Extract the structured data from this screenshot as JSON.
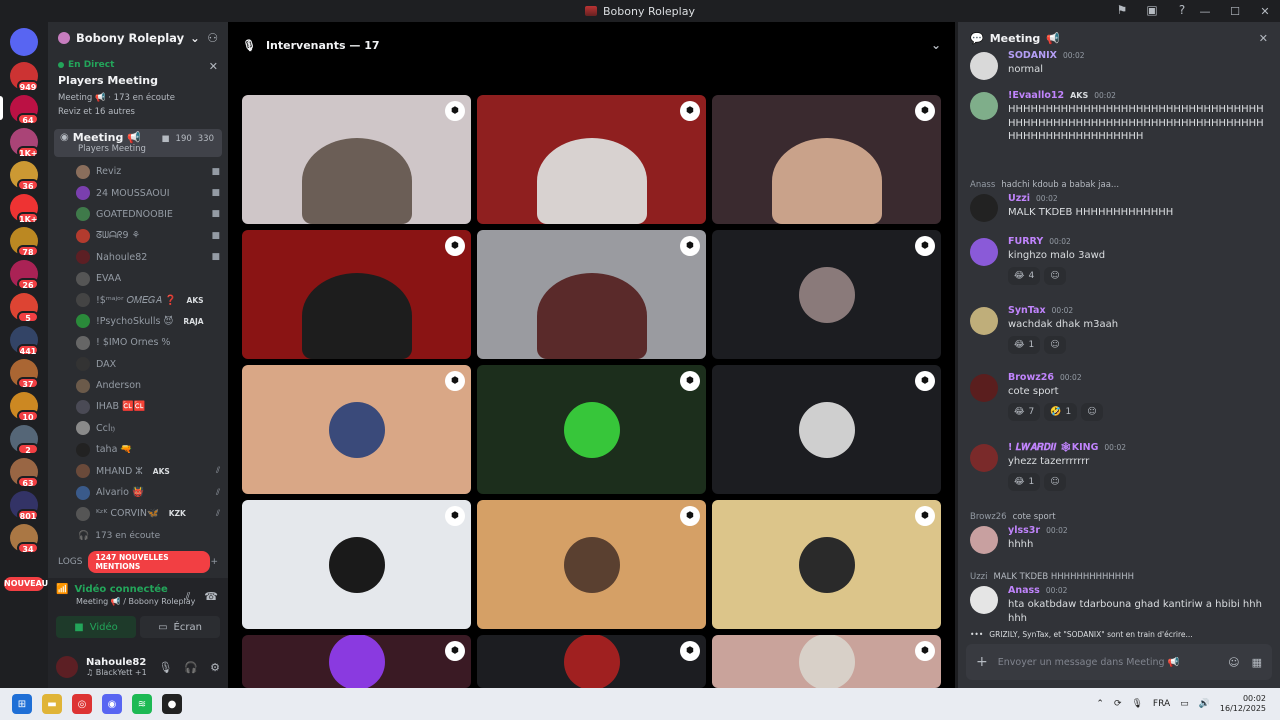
{
  "window": {
    "title": "Bobony Roleplay",
    "controls": [
      "—",
      "☐",
      "✕"
    ]
  },
  "rail": {
    "badges": [
      "949",
      "64",
      "1K+",
      "36",
      "1K+",
      "78",
      "26",
      "5",
      "441",
      "37",
      "10",
      "2",
      "63",
      "801",
      "34"
    ],
    "nouveau": "NOUVEAU"
  },
  "sidebar": {
    "guild_name": "Bobony Roleplay",
    "live_label": "En Direct",
    "event_name": "Players Meeting",
    "event_meta": "Meeting 📢 · 173 en écoute",
    "event_reviz": "Reviz et 16 autres",
    "channel": {
      "name": "Meeting",
      "sub": "Players Meeting",
      "cams": "190",
      "listeners": "330"
    },
    "members": [
      {
        "name": "Reviz",
        "tag": "",
        "right": "cam",
        "color": "#8a6e5c"
      },
      {
        "name": "24 MOUSSAOUI",
        "tag": "",
        "right": "cam",
        "color": "#7a3fae"
      },
      {
        "name": "GOATEDNOOBIE",
        "tag": "",
        "right": "cam",
        "color": "#3f7a4a"
      },
      {
        "name": "ᘔᗯᗩᖇ9 ⚘",
        "tag": "",
        "right": "cam",
        "color": "#b33b2e"
      },
      {
        "name": "Nahoule82",
        "tag": "",
        "right": "cam",
        "color": "#5c1f24"
      },
      {
        "name": "EVAA",
        "tag": "",
        "right": "",
        "color": "#555"
      },
      {
        "name": "!$ᵐᵃʲᵒʳ 𝑂𝑀𝐸𝐺𝐴 ❓",
        "tag": "AKS",
        "right": "",
        "color": "#444"
      },
      {
        "name": "!PsychoSkulls 😈",
        "tag": "RAJA",
        "right": "",
        "color": "#2a8a3a"
      },
      {
        "name": "! $IMO Ornes %",
        "tag": "",
        "right": "",
        "color": "#666"
      },
      {
        "name": "DAX",
        "tag": "",
        "right": "",
        "color": "#333"
      },
      {
        "name": "Anderson",
        "tag": "",
        "right": "",
        "color": "#6b5a4a"
      },
      {
        "name": "IHAB 🆑🆑",
        "tag": "",
        "right": "",
        "color": "#4a4a55"
      },
      {
        "name": "Ccl𝔶",
        "tag": "",
        "right": "",
        "color": "#8a8a8a"
      },
      {
        "name": "taha 🔫",
        "tag": "",
        "right": "",
        "color": "#222"
      },
      {
        "name": "MHAND ⵣ",
        "tag": "AKS",
        "right": "mute",
        "color": "#6a4a3a"
      },
      {
        "name": "Alvario 👹",
        "tag": "",
        "right": "mute",
        "color": "#3a5a8a"
      },
      {
        "name": "ᴷᶻᴷ CORVIN🦋",
        "tag": "KZK",
        "right": "mute",
        "color": "#555"
      }
    ],
    "listeners": "173 en écoute",
    "logs_label": "LOGS",
    "mentions": "1247 NOUVELLES MENTIONS",
    "voice_title": "Vidéo connectée",
    "voice_sub": "Meeting 📢 / Bobony Roleplay",
    "video_btn": "Vidéo",
    "screen_btn": "Écran",
    "user_name": "Nahoule82",
    "user_status": "♫ BlackYett +1"
  },
  "stage": {
    "header": "Intervenants — 17",
    "tiles": [
      {
        "kind": "person",
        "bg": "#cfc6c8",
        "fg": "#6b5e56"
      },
      {
        "kind": "person",
        "bg": "#8f1f1f",
        "fg": "#d8d2d0"
      },
      {
        "kind": "person",
        "bg": "#3a2a2f",
        "fg": "#c9a28a"
      },
      {
        "kind": "person",
        "bg": "#8a1414",
        "fg": "#1d1d1d"
      },
      {
        "kind": "person",
        "bg": "#9a9ba0",
        "fg": "#5a2a2a"
      },
      {
        "kind": "avatar",
        "bg": "#1c1d21",
        "fg": "#8a7a7a"
      },
      {
        "kind": "avatar",
        "bg": "#d9a786",
        "fg": "#3a4a7a"
      },
      {
        "kind": "avatar",
        "bg": "#1c2e1c",
        "fg": "#37c63a"
      },
      {
        "kind": "avatar",
        "bg": "#1c1d21",
        "fg": "#cfcfcf"
      },
      {
        "kind": "avatar",
        "bg": "#e5e8ec",
        "fg": "#1a1a1a"
      },
      {
        "kind": "avatar",
        "bg": "#d5a066",
        "fg": "#5a4030"
      },
      {
        "kind": "avatar",
        "bg": "#dcc58a",
        "fg": "#2a2a2a"
      },
      {
        "kind": "avatar",
        "bg": "#3a1a24",
        "fg": "#8a3ae0"
      },
      {
        "kind": "avatar",
        "bg": "#1c1d21",
        "fg": "#a02020"
      },
      {
        "kind": "avatar",
        "bg": "#c9a39b",
        "fg": "#d8d0c8"
      }
    ]
  },
  "chat": {
    "title": "Meeting",
    "messages": [
      {
        "author": "SODANIX",
        "color": "#b49ef5",
        "time": "00:02",
        "text": "normal",
        "tag": ""
      },
      {
        "author": "!Evaallo12",
        "color": "#c084fc",
        "time": "00:02",
        "tag": "AKS",
        "text": "HHHHHHHHHHHHHHHHHHHHHHHHHHHHHHHHHHHHHHHHHHHHHHHHHHHHHHHHHHHHHHHHHHHHHHHHHHHHHHHHHHHHHH"
      },
      {
        "reply_author": "Anass",
        "reply_text": "hadchi kdoub a babak jaa...",
        "author": "Uzzi",
        "color": "#c084fc",
        "time": "00:02",
        "text": "MALK TKDEB HHHHHHHHHHHHH"
      },
      {
        "author": "FURRY",
        "color": "#c084fc",
        "time": "00:02",
        "text": "kinghzo malo 3awd",
        "reactions": [
          {
            "e": "😂",
            "n": "4"
          }
        ]
      },
      {
        "author": "SynTax",
        "color": "#c084fc",
        "time": "00:02",
        "text": "wachdak dhak m3aah",
        "reactions": [
          {
            "e": "😂",
            "n": "1"
          }
        ]
      },
      {
        "author": "Browz26",
        "color": "#c084fc",
        "time": "00:02",
        "text": "cote sport",
        "reactions": [
          {
            "e": "😂",
            "n": "7"
          },
          {
            "e": "🤣",
            "n": "1"
          }
        ]
      },
      {
        "author": "! 𝑳𝑾𝑨𝑹𝑫𝑰𝑰 🕸KING",
        "color": "#c084fc",
        "time": "00:02",
        "text": "yhezz tazerrrrrrr",
        "reactions": [
          {
            "e": "😂",
            "n": "1"
          }
        ]
      },
      {
        "reply_author": "Browz26",
        "reply_text": "cote sport",
        "author": "ylss3r",
        "color": "#c084fc",
        "time": "00:02",
        "text": "hhhh"
      },
      {
        "reply_author": "Uzzi",
        "reply_text": "MALK TKDEB HHHHHHHHHHHHH",
        "author": "Anass",
        "color": "#c084fc",
        "time": "00:02",
        "text": "hta okatbdaw tdarbouna ghad kantiriw a hbibi hhhhhh"
      }
    ],
    "typing": "GRIZILY, SynTax, et \"SODANIX\" sont en train d'écrire...",
    "composer_placeholder": "Envoyer un message dans Meeting 📢"
  },
  "taskbar": {
    "lang": "FRA",
    "time": "00:02",
    "date": "16/12/2025"
  }
}
